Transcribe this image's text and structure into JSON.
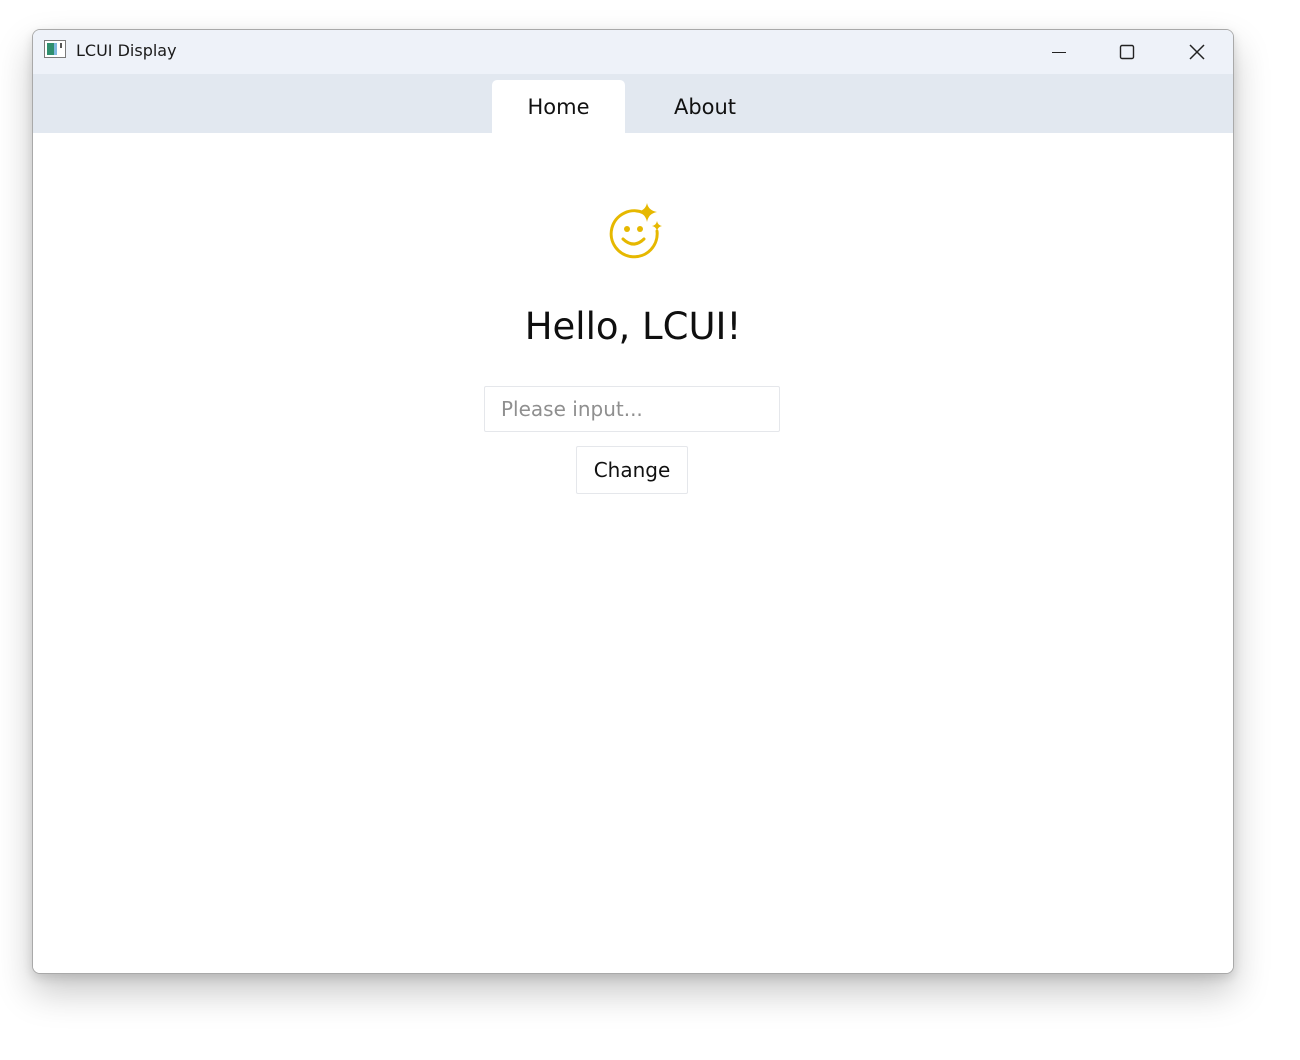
{
  "window": {
    "title": "LCUI Display",
    "controls": {
      "minimize": "minimize-icon",
      "maximize": "maximize-icon",
      "close": "close-icon"
    }
  },
  "tabs": [
    {
      "label": "Home",
      "active": true
    },
    {
      "label": "About",
      "active": false
    }
  ],
  "home": {
    "icon": "smile-sparkle-icon",
    "icon_color": "#e6b800",
    "greeting": "Hello, LCUI!",
    "input": {
      "value": "",
      "placeholder": "Please input..."
    },
    "button_label": "Change"
  },
  "colors": {
    "titlebar": "#eef2f9",
    "tabbar": "#e2e8f0",
    "active_tab": "#ffffff"
  }
}
